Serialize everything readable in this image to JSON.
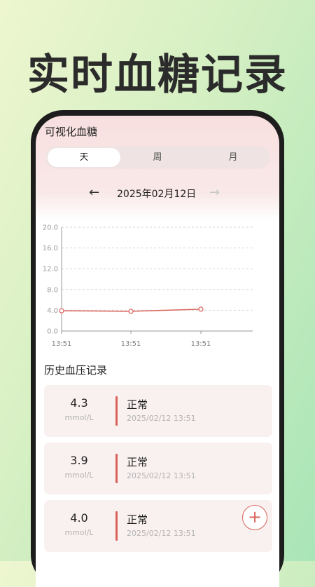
{
  "hero": {
    "title": "实时血糖记录"
  },
  "app": {
    "title": "可视化血糖"
  },
  "tabs": [
    {
      "label": "天",
      "active": true
    },
    {
      "label": "周",
      "active": false
    },
    {
      "label": "月",
      "active": false
    }
  ],
  "date_nav": {
    "date": "2025年02月12日",
    "prev_icon": "arrow-left-icon",
    "next_icon": "arrow-right-icon"
  },
  "chart_data": {
    "type": "line",
    "ylim": [
      0,
      20
    ],
    "yticks": [
      "20.0",
      "16.0",
      "12.0",
      "8.0",
      "4.0",
      "0.0"
    ],
    "x": [
      "13:51",
      "13:51",
      "13:51"
    ],
    "series": [
      {
        "values": [
          3.9,
          3.8,
          4.2
        ]
      }
    ],
    "line_color": "#d9635b",
    "grid": true
  },
  "history": {
    "title": "历史血压记录",
    "records": [
      {
        "value": "4.3",
        "unit": "mmol/L",
        "status": "正常",
        "time": "2025/02/12 13:51"
      },
      {
        "value": "3.9",
        "unit": "mmol/L",
        "status": "正常",
        "time": "2025/02/12 13:51"
      },
      {
        "value": "4.0",
        "unit": "mmol/L",
        "status": "正常",
        "time": "2025/02/12 13:51"
      }
    ]
  },
  "fab": {
    "label": "+",
    "icon": "plus-icon"
  },
  "colors": {
    "accent": "#d9635b",
    "title": "#2b2b2b"
  }
}
